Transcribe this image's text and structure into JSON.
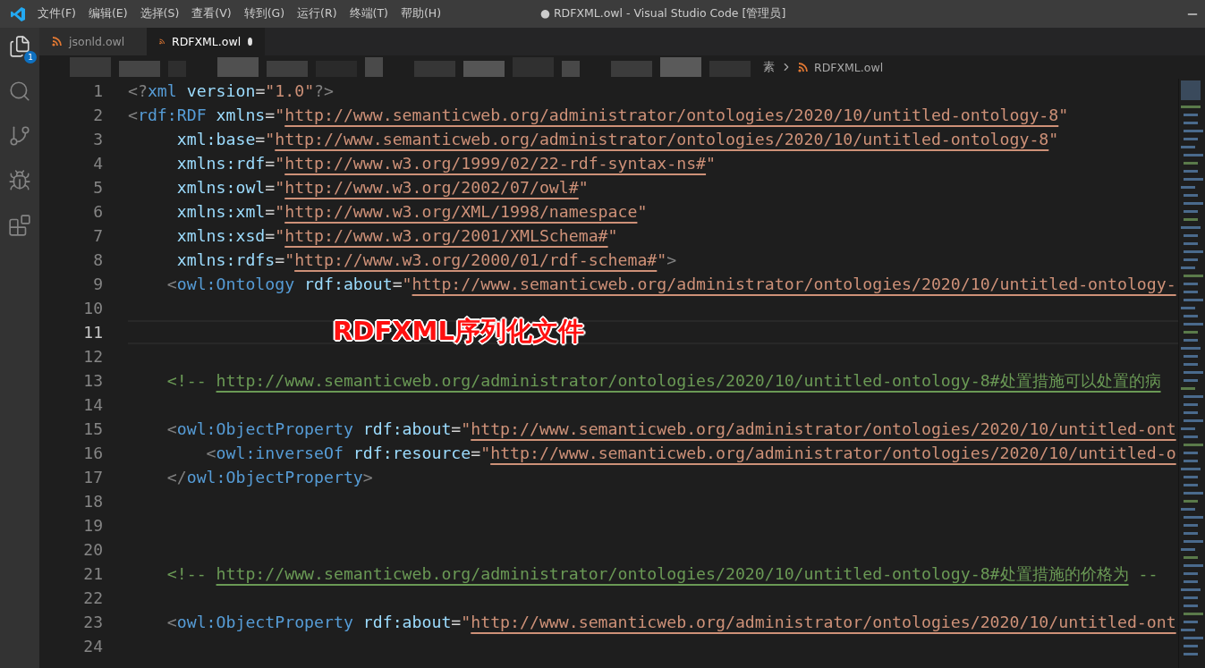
{
  "window": {
    "title": "● RDFXML.owl - Visual Studio Code [管理员]"
  },
  "menu": [
    "文件(F)",
    "编辑(E)",
    "选择(S)",
    "查看(V)",
    "转到(G)",
    "运行(R)",
    "终端(T)",
    "帮助(H)"
  ],
  "activity_bar": {
    "explorer_badge": "1"
  },
  "tabs": [
    {
      "label": "jsonld.owl",
      "selected": false,
      "modified": false
    },
    {
      "label": "RDFXML.owl",
      "selected": true,
      "modified": true
    }
  ],
  "breadcrumb": {
    "cut_text": "素",
    "file": "RDFXML.owl"
  },
  "lines": [
    {
      "number": "1",
      "current": false,
      "tokens": [
        {
          "kind": "punct",
          "text": "<?"
        },
        {
          "kind": "tag",
          "text": "xml"
        },
        {
          "kind": "attr",
          "text": " version"
        },
        {
          "kind": "plain",
          "text": "="
        },
        {
          "kind": "str",
          "text": "\"1.0\""
        },
        {
          "kind": "punct",
          "text": "?>"
        }
      ]
    },
    {
      "number": "2",
      "current": false,
      "tokens": [
        {
          "kind": "punct",
          "text": "<"
        },
        {
          "kind": "tag",
          "text": "rdf:RDF"
        },
        {
          "kind": "attr",
          "text": " xmlns"
        },
        {
          "kind": "plain",
          "text": "="
        },
        {
          "kind": "str",
          "text": "\""
        },
        {
          "kind": "url",
          "text": "http://www.semanticweb.org/administrator/ontologies/2020/10/untitled-ontology-8"
        },
        {
          "kind": "str",
          "text": "\""
        }
      ]
    },
    {
      "number": "3",
      "current": false,
      "tokens": [
        {
          "kind": "attr",
          "text": "     xml:base"
        },
        {
          "kind": "plain",
          "text": "="
        },
        {
          "kind": "str",
          "text": "\""
        },
        {
          "kind": "url",
          "text": "http://www.semanticweb.org/administrator/ontologies/2020/10/untitled-ontology-8"
        },
        {
          "kind": "str",
          "text": "\""
        }
      ]
    },
    {
      "number": "4",
      "current": false,
      "tokens": [
        {
          "kind": "attr",
          "text": "     xmlns:rdf"
        },
        {
          "kind": "plain",
          "text": "="
        },
        {
          "kind": "str",
          "text": "\""
        },
        {
          "kind": "url",
          "text": "http://www.w3.org/1999/02/22-rdf-syntax-ns#"
        },
        {
          "kind": "str",
          "text": "\""
        }
      ]
    },
    {
      "number": "5",
      "current": false,
      "tokens": [
        {
          "kind": "attr",
          "text": "     xmlns:owl"
        },
        {
          "kind": "plain",
          "text": "="
        },
        {
          "kind": "str",
          "text": "\""
        },
        {
          "kind": "url",
          "text": "http://www.w3.org/2002/07/owl#"
        },
        {
          "kind": "str",
          "text": "\""
        }
      ]
    },
    {
      "number": "6",
      "current": false,
      "tokens": [
        {
          "kind": "attr",
          "text": "     xmlns:xml"
        },
        {
          "kind": "plain",
          "text": "="
        },
        {
          "kind": "str",
          "text": "\""
        },
        {
          "kind": "url",
          "text": "http://www.w3.org/XML/1998/namespace"
        },
        {
          "kind": "str",
          "text": "\""
        }
      ]
    },
    {
      "number": "7",
      "current": false,
      "tokens": [
        {
          "kind": "attr",
          "text": "     xmlns:xsd"
        },
        {
          "kind": "plain",
          "text": "="
        },
        {
          "kind": "str",
          "text": "\""
        },
        {
          "kind": "url",
          "text": "http://www.w3.org/2001/XMLSchema#"
        },
        {
          "kind": "str",
          "text": "\""
        }
      ]
    },
    {
      "number": "8",
      "current": false,
      "tokens": [
        {
          "kind": "attr",
          "text": "     xmlns:rdfs"
        },
        {
          "kind": "plain",
          "text": "="
        },
        {
          "kind": "str",
          "text": "\""
        },
        {
          "kind": "url",
          "text": "http://www.w3.org/2000/01/rdf-schema#"
        },
        {
          "kind": "str",
          "text": "\""
        },
        {
          "kind": "punct",
          "text": ">"
        }
      ]
    },
    {
      "number": "9",
      "current": false,
      "tokens": [
        {
          "kind": "punct",
          "text": "    <"
        },
        {
          "kind": "tag",
          "text": "owl:Ontology"
        },
        {
          "kind": "attr",
          "text": " rdf:about"
        },
        {
          "kind": "plain",
          "text": "="
        },
        {
          "kind": "str",
          "text": "\""
        },
        {
          "kind": "url",
          "text": "http://www.semanticweb.org/administrator/ontologies/2020/10/untitled-ontology-"
        }
      ]
    },
    {
      "number": "10",
      "current": false
    },
    {
      "number": "11",
      "current": true
    },
    {
      "number": "12",
      "current": false
    },
    {
      "number": "13",
      "current": false,
      "tokens": [
        {
          "kind": "comment",
          "text": "    <!-- "
        },
        {
          "kind": "comment_url",
          "text": "http://www.semanticweb.org/administrator/ontologies/2020/10/untitled-ontology-8#处置措施可以处置的病"
        }
      ]
    },
    {
      "number": "14",
      "current": false
    },
    {
      "number": "15",
      "current": false,
      "tokens": [
        {
          "kind": "punct",
          "text": "    <"
        },
        {
          "kind": "tag",
          "text": "owl:ObjectProperty"
        },
        {
          "kind": "attr",
          "text": " rdf:about"
        },
        {
          "kind": "plain",
          "text": "="
        },
        {
          "kind": "str",
          "text": "\""
        },
        {
          "kind": "url",
          "text": "http://www.semanticweb.org/administrator/ontologies/2020/10/untitled-ont"
        }
      ]
    },
    {
      "number": "16",
      "current": false,
      "tokens": [
        {
          "kind": "punct",
          "text": "        <"
        },
        {
          "kind": "tag",
          "text": "owl:inverseOf"
        },
        {
          "kind": "attr",
          "text": " rdf:resource"
        },
        {
          "kind": "plain",
          "text": "="
        },
        {
          "kind": "str",
          "text": "\""
        },
        {
          "kind": "url",
          "text": "http://www.semanticweb.org/administrator/ontologies/2020/10/untitled-o"
        }
      ]
    },
    {
      "number": "17",
      "current": false,
      "tokens": [
        {
          "kind": "punct",
          "text": "    </"
        },
        {
          "kind": "tag",
          "text": "owl:ObjectProperty"
        },
        {
          "kind": "punct",
          "text": ">"
        }
      ]
    },
    {
      "number": "18",
      "current": false
    },
    {
      "number": "19",
      "current": false
    },
    {
      "number": "20",
      "current": false
    },
    {
      "number": "21",
      "current": false,
      "tokens": [
        {
          "kind": "comment",
          "text": "    <!-- "
        },
        {
          "kind": "comment_url",
          "text": "http://www.semanticweb.org/administrator/ontologies/2020/10/untitled-ontology-8#处置措施的价格为"
        },
        {
          "kind": "comment",
          "text": " --"
        }
      ]
    },
    {
      "number": "22",
      "current": false
    },
    {
      "number": "23",
      "current": false,
      "tokens": [
        {
          "kind": "punct",
          "text": "    <"
        },
        {
          "kind": "tag",
          "text": "owl:ObjectProperty"
        },
        {
          "kind": "attr",
          "text": " rdf:about"
        },
        {
          "kind": "plain",
          "text": "="
        },
        {
          "kind": "str",
          "text": "\""
        },
        {
          "kind": "url",
          "text": "http://www.semanticweb.org/administrator/ontologies/2020/10/untitled-ont"
        }
      ]
    },
    {
      "number": "24",
      "current": false
    }
  ],
  "overlay_caption": "RDFXML序列化文件"
}
